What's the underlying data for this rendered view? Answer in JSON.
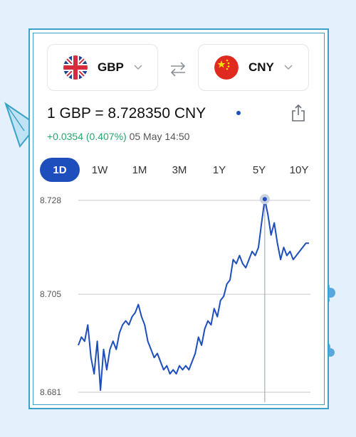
{
  "from_currency": {
    "code": "GBP",
    "flag": "uk-flag-icon"
  },
  "to_currency": {
    "code": "CNY",
    "flag": "china-flag-icon"
  },
  "rate_text": "1 GBP = 8.728350 CNY",
  "change": {
    "value": "+0.0354 (0.407%)",
    "time": "05 May 14:50"
  },
  "tabs": [
    "1D",
    "1W",
    "1M",
    "3M",
    "1Y",
    "5Y",
    "10Y"
  ],
  "active_tab": "1D",
  "colors": {
    "accent": "#1d4ebc",
    "positive": "#23a86b",
    "frame": "#3aa1c7"
  },
  "chart_data": {
    "type": "line",
    "title": "",
    "xlabel": "",
    "ylabel": "",
    "ylim": [
      8.681,
      8.728
    ],
    "yticks": [
      "8.728",
      "8.705",
      "8.681"
    ],
    "series": [
      {
        "values": [
          8.6925,
          8.6945,
          8.6935,
          8.6975,
          8.6895,
          8.6855,
          8.6935,
          8.6815,
          8.6915,
          8.6865,
          8.6915,
          8.6935,
          8.6915,
          8.6955,
          8.6975,
          8.6985,
          8.6975,
          8.6995,
          8.7005,
          8.7025,
          8.6995,
          8.6975,
          8.6935,
          8.6915,
          8.6895,
          8.6905,
          8.6885,
          8.6865,
          8.6875,
          8.6855,
          8.6865,
          8.6855,
          8.6875,
          8.6865,
          8.6875,
          8.6865,
          8.6885,
          8.6905,
          8.6945,
          8.6925,
          8.6965,
          8.6985,
          8.6975,
          8.7015,
          8.6995,
          8.7035,
          8.7045,
          8.7075,
          8.7085,
          8.7135,
          8.7125,
          8.7145,
          8.7125,
          8.7115,
          8.7135,
          8.7155,
          8.7145,
          8.7165,
          8.7225,
          8.7283,
          8.7245,
          8.7195,
          8.7225,
          8.7175,
          8.7135,
          8.7165,
          8.7145,
          8.7155,
          8.7135,
          8.7145,
          8.7155,
          8.7165,
          8.7175,
          8.7175
        ]
      }
    ],
    "highlight": {
      "value": 8.7283,
      "label": ""
    },
    "grid": true
  }
}
